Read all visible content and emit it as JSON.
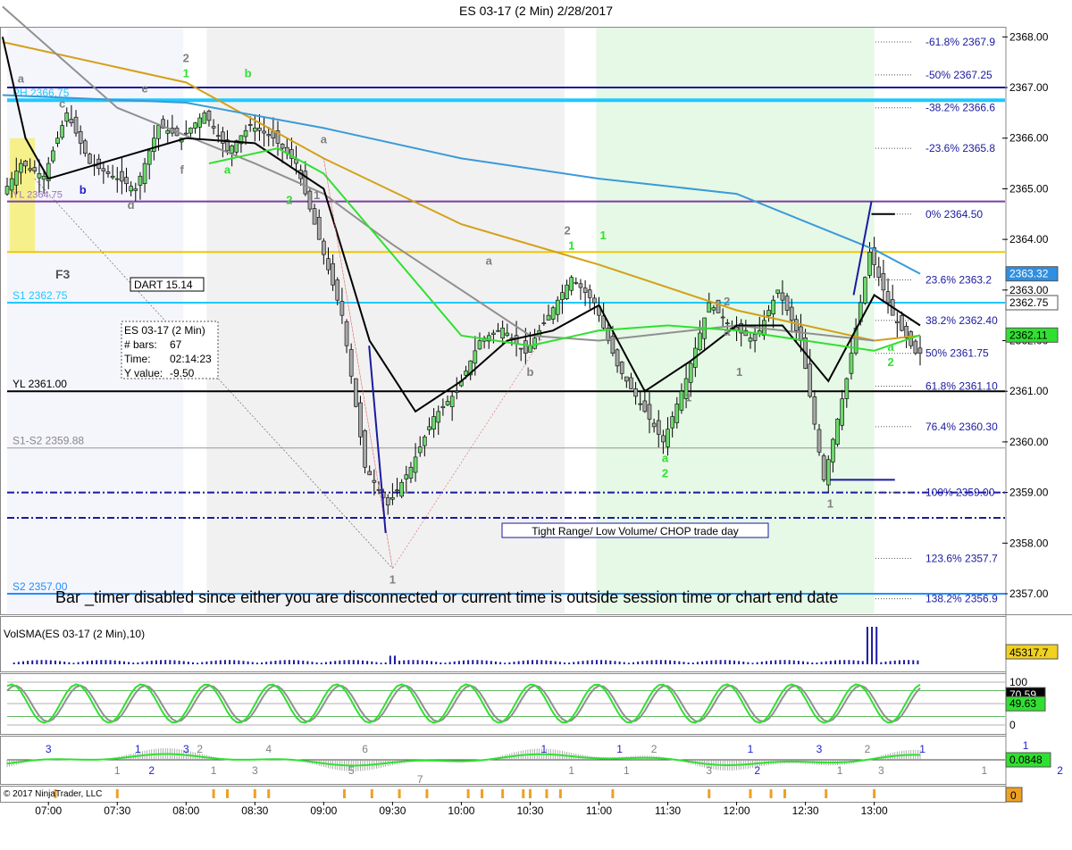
{
  "header": {
    "title": "ES 03-17 (2 Min)  2/28/2017"
  },
  "footer": {
    "copyright": "© 2017 NinjaTrader, LLC"
  },
  "price_panel": {
    "ylim": [
      2357.0,
      2368.2
    ],
    "ticks": [
      "2357.00",
      "2358.00",
      "2359.00",
      "2360.00",
      "2361.00",
      "2362.00",
      "2363.00",
      "2364.00",
      "2365.00",
      "2366.00",
      "2367.00",
      "2368.00"
    ],
    "tick_values": [
      2357,
      2358,
      2359,
      2360,
      2361,
      2362,
      2363,
      2364,
      2365,
      2366,
      2367,
      2368
    ],
    "badges": [
      {
        "label": "2363.32",
        "value": 2363.32,
        "bg": "#2f8fe0",
        "fg": "#ffffff"
      },
      {
        "label": "2362.75",
        "value": 2362.75,
        "bg": "#ffffff",
        "fg": "#000000"
      },
      {
        "label": "2362.11",
        "value": 2362.11,
        "bg": "#30e030",
        "fg": "#000000"
      }
    ],
    "levels": [
      {
        "label": "PH 2366.75",
        "value": 2366.75,
        "color": "#1ec8ff",
        "width": 4
      },
      {
        "label": "S1 2362.75",
        "value": 2362.75,
        "color": "#1ec8ff",
        "width": 2
      },
      {
        "label": "YL 2361.00",
        "value": 2361.0,
        "color": "#000000",
        "width": 2
      },
      {
        "label": "S1-S2 2359.88",
        "value": 2359.88,
        "color": "#999999",
        "width": 1
      },
      {
        "label": "S2 2357.00",
        "value": 2357.0,
        "color": "#1e90ff",
        "width": 2
      }
    ],
    "fib": [
      {
        "label": "-61.8%  2367.9",
        "value": 2367.9
      },
      {
        "label": "-50%  2367.25",
        "value": 2367.25
      },
      {
        "label": "-38.2%  2366.6",
        "value": 2366.6
      },
      {
        "label": "-23.6%  2365.8",
        "value": 2365.8
      },
      {
        "label": "0%  2364.50",
        "value": 2364.5
      },
      {
        "label": "23.6%  2363.2",
        "value": 2363.2
      },
      {
        "label": "38.2%  2362.40",
        "value": 2362.4
      },
      {
        "label": "50%  2361.75",
        "value": 2361.75
      },
      {
        "label": "61.8%  2361.10",
        "value": 2361.1
      },
      {
        "label": "76.4%  2360.30",
        "value": 2360.3
      },
      {
        "label": "100%  2359.00",
        "value": 2359.0
      },
      {
        "label": "123.6%  2357.7",
        "value": 2357.7
      },
      {
        "label": "138.2%  2356.9",
        "value": 2356.9
      }
    ],
    "notes": {
      "dart": "DART 15.14",
      "tight_range": "Tight Range/ Low Volume/ CHOP trade day",
      "timer_msg": "Bar _timer disabled since either you are disconnected or current time is outside session time or chart end date",
      "f3": "F3",
      "overlap_label": "YL 2364.75"
    },
    "info_box": {
      "lines": [
        "ES 03-17 (2 Min)",
        "# bars:",
        "Time:",
        "Y value:"
      ],
      "values": [
        "",
        "67",
        "02:14:23",
        "-9.50"
      ]
    },
    "swing_labels": [
      {
        "text": "a",
        "t": 6.8,
        "p": 2367.1,
        "color": "#808080"
      },
      {
        "text": "a",
        "t": 6.5,
        "p": 2365.8,
        "color": "#808080"
      },
      {
        "text": "1",
        "t": 6.35,
        "p": 2363.6,
        "color": "#808080"
      },
      {
        "text": "c",
        "t": 7.1,
        "p": 2366.6,
        "color": "#808080"
      },
      {
        "text": "b",
        "t": 7.25,
        "p": 2364.9,
        "color": "#1e1ecc"
      },
      {
        "text": "d",
        "t": 7.6,
        "p": 2364.6,
        "color": "#808080"
      },
      {
        "text": "e",
        "t": 7.7,
        "p": 2366.9,
        "color": "#808080"
      },
      {
        "text": "2",
        "t": 8.0,
        "p": 2367.5,
        "color": "#808080"
      },
      {
        "text": "1",
        "t": 8.0,
        "p": 2367.2,
        "color": "#30e030"
      },
      {
        "text": "b",
        "t": 8.45,
        "p": 2367.2,
        "color": "#30e030"
      },
      {
        "text": "f",
        "t": 7.97,
        "p": 2365.3,
        "color": "#808080"
      },
      {
        "text": "a",
        "t": 8.3,
        "p": 2365.3,
        "color": "#30e030"
      },
      {
        "text": "2",
        "t": 8.75,
        "p": 2364.7,
        "color": "#30e030"
      },
      {
        "text": "1",
        "t": 8.95,
        "p": 2364.8,
        "color": "#808080"
      },
      {
        "text": "a",
        "t": 9.0,
        "p": 2365.9,
        "color": "#808080"
      },
      {
        "text": "1",
        "t": 9.5,
        "p": 2357.2,
        "color": "#808080"
      },
      {
        "text": "a",
        "t": 10.2,
        "p": 2363.5,
        "color": "#808080"
      },
      {
        "text": "b",
        "t": 10.5,
        "p": 2361.3,
        "color": "#808080"
      },
      {
        "text": "2",
        "t": 10.77,
        "p": 2364.1,
        "color": "#808080"
      },
      {
        "text": "1",
        "t": 10.8,
        "p": 2363.8,
        "color": "#30e030"
      },
      {
        "text": "1",
        "t": 11.03,
        "p": 2364.0,
        "color": "#30e030"
      },
      {
        "text": "a",
        "t": 11.48,
        "p": 2359.6,
        "color": "#30e030"
      },
      {
        "text": "2",
        "t": 11.48,
        "p": 2359.3,
        "color": "#30e030"
      },
      {
        "text": "1",
        "t": 11.65,
        "p": 2360.8,
        "color": "#808080"
      },
      {
        "text": "2",
        "t": 11.93,
        "p": 2362.7,
        "color": "#808080"
      },
      {
        "text": "a",
        "t": 11.93,
        "p": 2362.1,
        "color": "#808080"
      },
      {
        "text": "1",
        "t": 12.02,
        "p": 2361.3,
        "color": "#808080"
      },
      {
        "text": "1",
        "t": 12.68,
        "p": 2358.7,
        "color": "#808080"
      },
      {
        "text": "a",
        "t": 13.12,
        "p": 2361.8,
        "color": "#30e030"
      },
      {
        "text": "2",
        "t": 13.12,
        "p": 2361.5,
        "color": "#30e030"
      }
    ]
  },
  "volume_panel": {
    "label": "VolSMA(ES 03-17 (2 Min),10)",
    "badge": {
      "label": "45317.7",
      "bg": "#f0d020",
      "fg": "#000000"
    },
    "ylim": [
      0,
      12000
    ]
  },
  "stoch_panel": {
    "ticks": [
      "100",
      "0"
    ],
    "tick_values": [
      100,
      0
    ],
    "badges": [
      {
        "label": "70.59",
        "value": 70.59,
        "bg": "#000000",
        "fg": "#ffffff"
      },
      {
        "label": "49.63",
        "value": 49.63,
        "bg": "#30e030",
        "fg": "#000000"
      }
    ],
    "ylim": [
      0,
      100
    ]
  },
  "osc_panel": {
    "badge": {
      "label": "0.0848",
      "bg": "#30e030",
      "fg": "#000000"
    },
    "wave_labels": [
      {
        "text": "1",
        "t": 6.3,
        "color": "#808080",
        "pos": "low"
      },
      {
        "text": "1",
        "t": 6.5,
        "color": "#1e1ecc",
        "pos": "high"
      },
      {
        "text": "2",
        "t": 6.55,
        "color": "#1e1ecc",
        "pos": "low"
      },
      {
        "text": "3",
        "t": 7.0,
        "color": "#1e1ecc",
        "pos": "high"
      },
      {
        "text": "1",
        "t": 7.5,
        "color": "#808080",
        "pos": "low"
      },
      {
        "text": "1",
        "t": 7.65,
        "color": "#1e1ecc",
        "pos": "high"
      },
      {
        "text": "2",
        "t": 7.75,
        "color": "#1e1ecc",
        "pos": "low"
      },
      {
        "text": "3",
        "t": 8.0,
        "color": "#1e1ecc",
        "pos": "high"
      },
      {
        "text": "2",
        "t": 8.1,
        "color": "#808080",
        "pos": "high"
      },
      {
        "text": "1",
        "t": 8.2,
        "color": "#808080",
        "pos": "low"
      },
      {
        "text": "3",
        "t": 8.5,
        "color": "#808080",
        "pos": "low"
      },
      {
        "text": "4",
        "t": 8.6,
        "color": "#808080",
        "pos": "high"
      },
      {
        "text": "5",
        "t": 9.2,
        "color": "#808080",
        "pos": "low"
      },
      {
        "text": "6",
        "t": 9.3,
        "color": "#808080",
        "pos": "high"
      },
      {
        "text": "7",
        "t": 9.7,
        "color": "#808080",
        "pos": "bottom"
      },
      {
        "text": "1",
        "t": 10.6,
        "color": "#1e1ecc",
        "pos": "high"
      },
      {
        "text": "1",
        "t": 10.8,
        "color": "#808080",
        "pos": "low"
      },
      {
        "text": "1",
        "t": 11.15,
        "color": "#1e1ecc",
        "pos": "high"
      },
      {
        "text": "1",
        "t": 11.2,
        "color": "#808080",
        "pos": "low"
      },
      {
        "text": "2",
        "t": 11.4,
        "color": "#808080",
        "pos": "high"
      },
      {
        "text": "3",
        "t": 11.8,
        "color": "#808080",
        "pos": "low"
      },
      {
        "text": "1",
        "t": 12.1,
        "color": "#1e1ecc",
        "pos": "high"
      },
      {
        "text": "2",
        "t": 12.15,
        "color": "#1e1ecc",
        "pos": "low"
      },
      {
        "text": "3",
        "t": 12.6,
        "color": "#1e1ecc",
        "pos": "high"
      },
      {
        "text": "1",
        "t": 12.75,
        "color": "#808080",
        "pos": "low"
      },
      {
        "text": "2",
        "t": 12.95,
        "color": "#808080",
        "pos": "high"
      },
      {
        "text": "3",
        "t": 13.05,
        "color": "#808080",
        "pos": "low"
      },
      {
        "text": "1",
        "t": 13.35,
        "color": "#1e1ecc",
        "pos": "high"
      },
      {
        "text": "1",
        "t": 13.8,
        "color": "#808080",
        "pos": "low"
      },
      {
        "text": "1",
        "t": 14.1,
        "color": "#1e1ecc",
        "pos": "top"
      },
      {
        "text": "2",
        "t": 14.35,
        "color": "#1e1ecc",
        "pos": "low"
      }
    ]
  },
  "signal_panel": {
    "badge": {
      "label": "0",
      "bg": "#f0a020",
      "fg": "#000000"
    },
    "color": "#f0a020"
  },
  "time_axis": {
    "ticks": [
      "07:00",
      "07:30",
      "08:00",
      "08:30",
      "09:00",
      "09:30",
      "10:00",
      "10:30",
      "11:00",
      "11:30",
      "12:00",
      "12:30",
      "13:00"
    ],
    "tick_hours": [
      7,
      7.5,
      8,
      8.5,
      9,
      9.5,
      10,
      10.5,
      11,
      11.5,
      12,
      12.5,
      13
    ],
    "xlim": [
      6.7,
      13.95
    ]
  },
  "chart_data": {
    "type": "candlestick",
    "title": "ES 03-17 (2 Min)  2/28/2017",
    "session_date": "2/28/2017",
    "x_label": "",
    "y_label": "",
    "x_range": [
      "06:40",
      "13:50"
    ],
    "y_range": [
      2357.0,
      2368.2
    ],
    "key_levels": [
      {
        "name": "PH",
        "value": 2366.75
      },
      {
        "name": "S1",
        "value": 2362.75
      },
      {
        "name": "YL",
        "value": 2361.0
      },
      {
        "name": "S1-S2",
        "value": 2359.88
      },
      {
        "name": "S2",
        "value": 2357.0
      }
    ],
    "last_values": {
      "sma_blue": 2363.32,
      "price": 2362.75,
      "sma_green": 2362.11
    },
    "price_path": [
      [
        "06:40",
        2364.75
      ],
      [
        "06:50",
        2365.5
      ],
      [
        "07:00",
        2365.25
      ],
      [
        "07:10",
        2366.5
      ],
      [
        "07:20",
        2365.5
      ],
      [
        "07:30",
        2365.25
      ],
      [
        "07:40",
        2365.0
      ],
      [
        "07:50",
        2366.25
      ],
      [
        "08:00",
        2366.0
      ],
      [
        "08:10",
        2366.5
      ],
      [
        "08:20",
        2365.75
      ],
      [
        "08:30",
        2366.25
      ],
      [
        "08:40",
        2366.0
      ],
      [
        "08:50",
        2365.5
      ],
      [
        "09:00",
        2364.0
      ],
      [
        "09:10",
        2362.5
      ],
      [
        "09:20",
        2359.5
      ],
      [
        "09:30",
        2358.75
      ],
      [
        "09:40",
        2359.5
      ],
      [
        "09:50",
        2360.5
      ],
      [
        "10:00",
        2361.0
      ],
      [
        "10:10",
        2362.0
      ],
      [
        "10:20",
        2362.25
      ],
      [
        "10:30",
        2361.75
      ],
      [
        "10:40",
        2362.5
      ],
      [
        "10:50",
        2363.25
      ],
      [
        "11:00",
        2362.75
      ],
      [
        "11:10",
        2361.5
      ],
      [
        "11:20",
        2360.75
      ],
      [
        "11:30",
        2360.0
      ],
      [
        "11:40",
        2361.25
      ],
      [
        "11:50",
        2362.75
      ],
      [
        "12:00",
        2362.25
      ],
      [
        "12:10",
        2362.0
      ],
      [
        "12:20",
        2363.0
      ],
      [
        "12:30",
        2362.0
      ],
      [
        "12:40",
        2359.25
      ],
      [
        "12:50",
        2361.25
      ],
      [
        "13:00",
        2363.75
      ],
      [
        "13:10",
        2362.5
      ],
      [
        "13:20",
        2361.75
      ]
    ],
    "moving_averages": [
      {
        "name": "gold",
        "color": "#d4a017",
        "points": [
          [
            "06:40",
            2367.9
          ],
          [
            "08:00",
            2367.1
          ],
          [
            "09:00",
            2365.6
          ],
          [
            "10:00",
            2364.3
          ],
          [
            "11:00",
            2363.5
          ],
          [
            "12:00",
            2362.6
          ],
          [
            "13:00",
            2362.0
          ],
          [
            "13:20",
            2362.1
          ]
        ]
      },
      {
        "name": "blue",
        "color": "#3a9ad9",
        "points": [
          [
            "06:40",
            2366.85
          ],
          [
            "08:00",
            2366.7
          ],
          [
            "09:00",
            2366.2
          ],
          [
            "10:00",
            2365.6
          ],
          [
            "11:00",
            2365.2
          ],
          [
            "12:00",
            2364.9
          ],
          [
            "13:00",
            2363.8
          ],
          [
            "13:20",
            2363.32
          ]
        ]
      },
      {
        "name": "gray",
        "color": "#909090",
        "points": [
          [
            "06:40",
            2368.6
          ],
          [
            "07:30",
            2366.6
          ],
          [
            "08:30",
            2365.5
          ],
          [
            "09:00",
            2364.9
          ],
          [
            "09:30",
            2363.9
          ],
          [
            "10:00",
            2363.0
          ],
          [
            "10:30",
            2362.1
          ],
          [
            "11:00",
            2362.0
          ],
          [
            "12:00",
            2362.3
          ],
          [
            "13:00",
            2362.0
          ]
        ]
      },
      {
        "name": "black",
        "color": "#000000",
        "points": [
          [
            "06:40",
            2368.0
          ],
          [
            "06:50",
            2366.0
          ],
          [
            "07:00",
            2365.2
          ],
          [
            "07:30",
            2365.6
          ],
          [
            "08:00",
            2366.0
          ],
          [
            "08:30",
            2365.9
          ],
          [
            "09:00",
            2365.0
          ],
          [
            "09:20",
            2362.0
          ],
          [
            "09:40",
            2360.6
          ],
          [
            "10:00",
            2361.2
          ],
          [
            "10:20",
            2362.0
          ],
          [
            "10:40",
            2362.2
          ],
          [
            "11:00",
            2362.7
          ],
          [
            "11:20",
            2361.0
          ],
          [
            "11:40",
            2361.6
          ],
          [
            "12:00",
            2362.3
          ],
          [
            "12:20",
            2362.3
          ],
          [
            "12:40",
            2361.2
          ],
          [
            "13:00",
            2362.9
          ],
          [
            "13:20",
            2362.3
          ]
        ]
      },
      {
        "name": "green",
        "color": "#30e030",
        "points": [
          [
            "08:10",
            2365.5
          ],
          [
            "08:40",
            2365.8
          ],
          [
            "09:00",
            2365.3
          ],
          [
            "10:00",
            2362.1
          ],
          [
            "10:30",
            2361.9
          ],
          [
            "11:00",
            2362.2
          ],
          [
            "11:30",
            2362.3
          ],
          [
            "12:00",
            2362.2
          ],
          [
            "12:30",
            2362.0
          ],
          [
            "13:00",
            2361.8
          ],
          [
            "13:20",
            2362.11
          ]
        ]
      }
    ],
    "volume_last": 45317.7,
    "stochastic_last": [
      70.59,
      49.63
    ],
    "oscillator_last": 0.0848
  }
}
